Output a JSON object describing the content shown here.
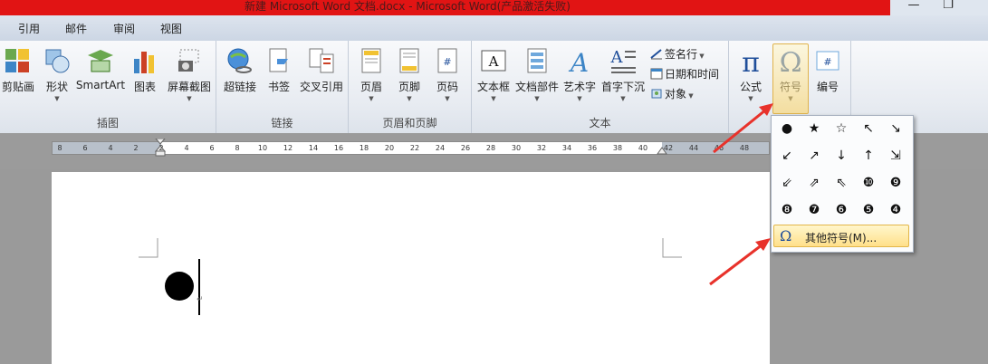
{
  "window": {
    "title": "新建 Microsoft Word 文档.docx  -  Microsoft Word(产品激活失败)",
    "minimize": "—",
    "restore": "❐"
  },
  "tabs": [
    "引用",
    "邮件",
    "审阅",
    "视图"
  ],
  "groups": {
    "illustrations": {
      "label": "插图",
      "buttons": [
        "剪贴画",
        "形状",
        "SmartArt",
        "图表",
        "屏幕截图"
      ]
    },
    "links": {
      "label": "链接",
      "buttons": [
        "超链接",
        "书签",
        "交叉引用"
      ]
    },
    "header_footer": {
      "label": "页眉和页脚",
      "buttons": [
        "页眉",
        "页脚",
        "页码"
      ]
    },
    "text": {
      "label": "文本",
      "buttons": [
        "文本框",
        "文档部件",
        "艺术字",
        "首字下沉"
      ],
      "small_buttons": [
        "签名行",
        "日期和时间",
        "对象"
      ]
    },
    "symbols": {
      "buttons": [
        "公式",
        "符号",
        "编号"
      ]
    }
  },
  "ruler": {
    "ticks": [
      "8",
      "6",
      "4",
      "2",
      "2",
      "4",
      "6",
      "8",
      "10",
      "12",
      "14",
      "16",
      "18",
      "20",
      "22",
      "24",
      "26",
      "28",
      "30",
      "32",
      "34",
      "36",
      "38",
      "40",
      "42",
      "44",
      "46",
      "48"
    ]
  },
  "symbol_dropdown": {
    "symbols": [
      "●",
      "★",
      "☆",
      "↖",
      "↘",
      "↙",
      "↗",
      "↓",
      "↑",
      "⇲",
      "⇙",
      "⇗",
      "⇖",
      "❿",
      "❾",
      "❽",
      "❼",
      "❻",
      "❺",
      "❹"
    ],
    "more_label": "其他符号(M)..."
  },
  "colors": {
    "titlebar": "#e11414",
    "annotation_arrow": "#e8322b",
    "highlight": "#ffd45e"
  }
}
